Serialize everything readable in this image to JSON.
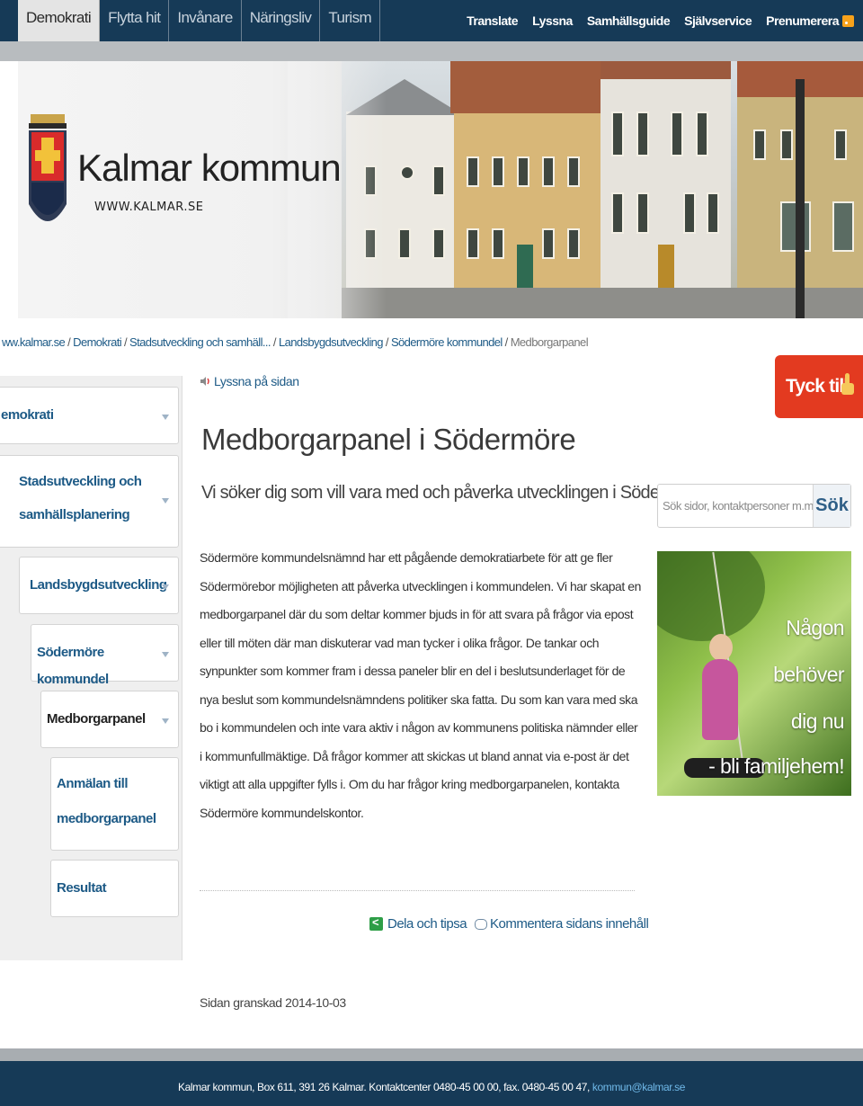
{
  "topnav": {
    "tabs": [
      "Demokrati",
      "Flytta hit",
      "Invånare",
      "Näringsliv",
      "Turism"
    ],
    "active_tab": "Demokrati",
    "utility": [
      "Translate",
      "Lyssna",
      "Samhällsguide",
      "Självservice",
      "Prenumerera"
    ]
  },
  "header": {
    "brand": "Kalmar kommun",
    "url": "WWW.KALMAR.SE"
  },
  "breadcrumb": {
    "items": [
      "ww.kalmar.se",
      "Demokrati",
      "Stadsutveckling och samhäll...",
      "Landsbygdsutveckling",
      "Södermöre kommundel"
    ],
    "current": "Medborgarpanel"
  },
  "sidebar": {
    "items": [
      "emokrati",
      "Stadsutveckling och",
      "samhällsplanering",
      "Landsbygdsutveckling",
      "Södermöre kommundel",
      "Medborgarpanel",
      "Anmälan till",
      "medborgarpanel",
      "Resultat"
    ]
  },
  "main": {
    "listen": "Lyssna på sidan",
    "title": "Medborgarpanel i Södermöre",
    "lead": "Vi söker dig som vill vara med och påverka utvecklingen i Södermöre",
    "body": "Södermöre kommundelsnämnd har ett pågående demokratiarbete för att ge fler Södermörebor möjligheten att påverka utvecklingen i kommundelen. Vi har skapat en medborgarpanel där du som deltar kommer bjuds in för att svara på frågor via epost eller till möten där man diskuterar vad man tycker i olika frågor. De tankar och synpunkter som kommer fram i dessa paneler blir en del i beslutsunderlaget för de nya beslut som kommundelsnämndens politiker ska fatta. Du som kan vara med ska bo i kommundelen och inte vara aktiv i någon av kommunens politiska nämnder eller i kommunfullmäktige. Då frågor kommer att skickas ut bland annat via e-post är det viktigt att alla uppgifter fylls i. Om du har frågor kring medborgarpanelen, kontakta Södermöre kommundelskontor.",
    "share": "Dela och tipsa",
    "comment": "Kommentera sidans innehåll",
    "reviewed": "Sidan granskad 2014-10-03"
  },
  "right": {
    "feedback": "Tyck till",
    "search_placeholder": "Sök sidor, kontaktpersoner m.m.",
    "search_button": "Sök",
    "ad_lines": [
      "Någon",
      "behöver",
      "dig nu",
      "- bli familjehem!"
    ]
  },
  "footer": {
    "text": "Kalmar kommun, Box 611, 391 26 Kalmar. Kontaktcenter 0480-45 00 00, fax. 0480-45 00 47,",
    "email": "kommun@kalmar.se"
  },
  "colors": {
    "navy": "#163a57",
    "link": "#1d5a86",
    "feedback_red": "#e33a20"
  }
}
